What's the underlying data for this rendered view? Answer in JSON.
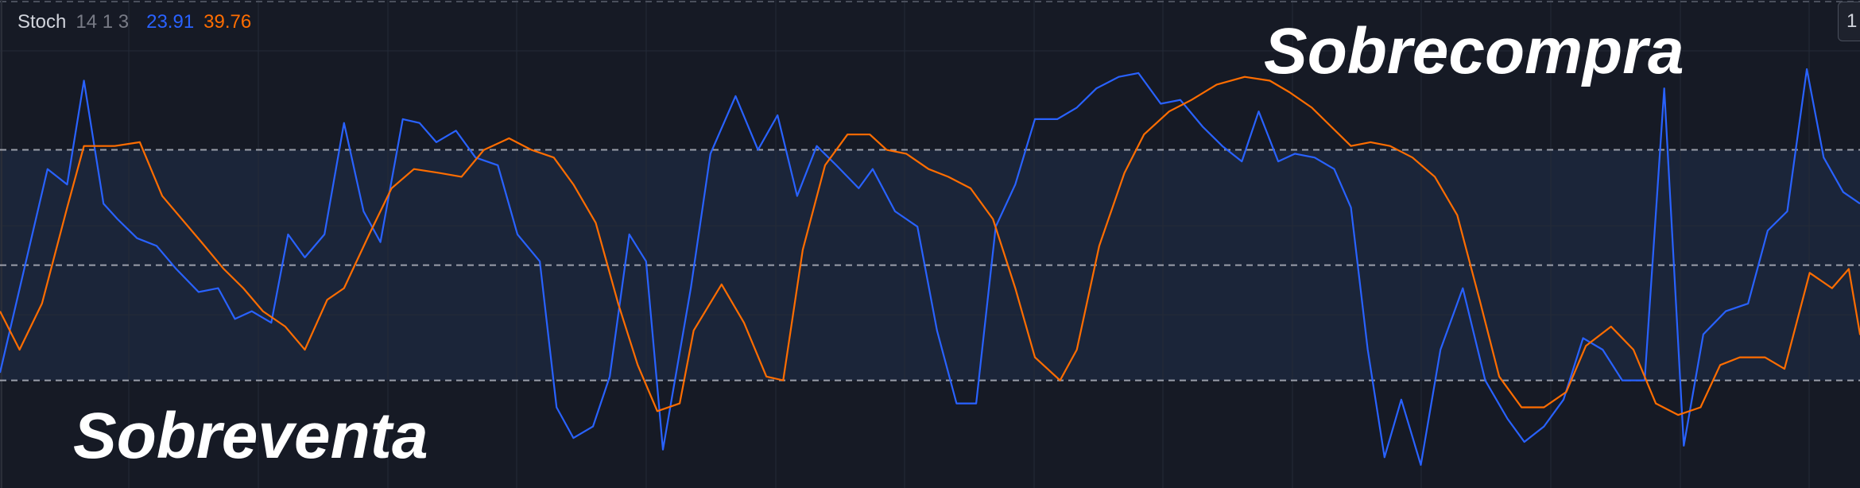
{
  "indicator": {
    "name": "Stoch",
    "params": "14 1 3",
    "k_value": "23.91",
    "d_value": "39.76",
    "k_color": "#2962ff",
    "d_color": "#ff6d00"
  },
  "annotations": {
    "overbought": "Sobrecompra",
    "oversold": "Sobreventa"
  },
  "edge_button": "1",
  "colors": {
    "background": "#161a25",
    "band_fill": "#1b2539",
    "grid": "#242a38",
    "band_line": "#b2b5be",
    "text": "#ffffff"
  },
  "chart_data": {
    "type": "line",
    "ylim": [
      -8,
      119
    ],
    "upper_band": 80,
    "middle_band": 50,
    "lower_band": 20,
    "grid": true,
    "series": [
      {
        "name": "%K",
        "color": "#2962ff",
        "points": [
          [
            0,
            22
          ],
          [
            34,
            75
          ],
          [
            48,
            71
          ],
          [
            60,
            98
          ],
          [
            74,
            66
          ],
          [
            84,
            62
          ],
          [
            98,
            57
          ],
          [
            112,
            55
          ],
          [
            126,
            49
          ],
          [
            142,
            43
          ],
          [
            156,
            44
          ],
          [
            168,
            36
          ],
          [
            180,
            38
          ],
          [
            194,
            35
          ],
          [
            206,
            58
          ],
          [
            218,
            52
          ],
          [
            232,
            58
          ],
          [
            246,
            87
          ],
          [
            260,
            64
          ],
          [
            272,
            56
          ],
          [
            288,
            88
          ],
          [
            300,
            87
          ],
          [
            312,
            82
          ],
          [
            326,
            85
          ],
          [
            340,
            78
          ],
          [
            356,
            76
          ],
          [
            370,
            58
          ],
          [
            386,
            51
          ],
          [
            398,
            13
          ],
          [
            410,
            5
          ],
          [
            424,
            8
          ],
          [
            436,
            21
          ],
          [
            450,
            58
          ],
          [
            462,
            51
          ],
          [
            474,
            2
          ],
          [
            494,
            44
          ],
          [
            508,
            79
          ],
          [
            526,
            94
          ],
          [
            542,
            80
          ],
          [
            556,
            89
          ],
          [
            570,
            68
          ],
          [
            584,
            81
          ],
          [
            598,
            76
          ],
          [
            614,
            70
          ],
          [
            624,
            75
          ],
          [
            640,
            64
          ],
          [
            656,
            60
          ],
          [
            670,
            33
          ],
          [
            684,
            14
          ],
          [
            698,
            14
          ],
          [
            712,
            60
          ],
          [
            726,
            71
          ],
          [
            740,
            88
          ],
          [
            756,
            88
          ],
          [
            770,
            91
          ],
          [
            784,
            96
          ],
          [
            800,
            99
          ],
          [
            814,
            100
          ],
          [
            830,
            92
          ],
          [
            844,
            93
          ],
          [
            860,
            86
          ],
          [
            874,
            81
          ],
          [
            888,
            77
          ],
          [
            900,
            90
          ],
          [
            914,
            77
          ],
          [
            926,
            79
          ],
          [
            940,
            78
          ],
          [
            954,
            75
          ],
          [
            966,
            65
          ],
          [
            978,
            28
          ],
          [
            990,
            0
          ],
          [
            1002,
            15
          ],
          [
            1016,
            -2
          ],
          [
            1030,
            28
          ],
          [
            1046,
            44
          ],
          [
            1062,
            20
          ],
          [
            1078,
            10
          ],
          [
            1090,
            4
          ],
          [
            1104,
            8
          ],
          [
            1118,
            15
          ],
          [
            1132,
            31
          ],
          [
            1146,
            28
          ],
          [
            1160,
            20
          ],
          [
            1176,
            20
          ],
          [
            1190,
            96
          ],
          [
            1204,
            3
          ],
          [
            1218,
            32
          ],
          [
            1234,
            38
          ],
          [
            1250,
            40
          ],
          [
            1264,
            59
          ],
          [
            1278,
            64
          ],
          [
            1292,
            101
          ],
          [
            1304,
            78
          ],
          [
            1318,
            69
          ],
          [
            1330,
            66
          ]
        ]
      },
      {
        "name": "%D",
        "color": "#ff6d00",
        "points": [
          [
            0,
            38
          ],
          [
            14,
            28
          ],
          [
            30,
            40
          ],
          [
            48,
            65
          ],
          [
            60,
            81
          ],
          [
            82,
            81
          ],
          [
            100,
            82
          ],
          [
            116,
            68
          ],
          [
            130,
            62
          ],
          [
            144,
            56
          ],
          [
            160,
            49
          ],
          [
            174,
            44
          ],
          [
            188,
            38
          ],
          [
            204,
            34
          ],
          [
            218,
            28
          ],
          [
            234,
            41
          ],
          [
            246,
            44
          ],
          [
            264,
            58
          ],
          [
            280,
            70
          ],
          [
            296,
            75
          ],
          [
            314,
            74
          ],
          [
            330,
            73
          ],
          [
            346,
            80
          ],
          [
            364,
            83
          ],
          [
            380,
            80
          ],
          [
            396,
            78
          ],
          [
            410,
            71
          ],
          [
            426,
            61
          ],
          [
            442,
            40
          ],
          [
            456,
            24
          ],
          [
            470,
            12
          ],
          [
            486,
            14
          ],
          [
            496,
            33
          ],
          [
            516,
            45
          ],
          [
            532,
            35
          ],
          [
            548,
            21
          ],
          [
            560,
            20
          ],
          [
            574,
            54
          ],
          [
            590,
            76
          ],
          [
            606,
            84
          ],
          [
            622,
            84
          ],
          [
            634,
            80
          ],
          [
            648,
            79
          ],
          [
            664,
            75
          ],
          [
            678,
            73
          ],
          [
            694,
            70
          ],
          [
            710,
            62
          ],
          [
            726,
            44
          ],
          [
            740,
            26
          ],
          [
            758,
            20
          ],
          [
            770,
            28
          ],
          [
            786,
            55
          ],
          [
            804,
            74
          ],
          [
            818,
            84
          ],
          [
            836,
            90
          ],
          [
            852,
            93
          ],
          [
            870,
            97
          ],
          [
            890,
            99
          ],
          [
            908,
            98
          ],
          [
            922,
            95
          ],
          [
            938,
            91
          ],
          [
            952,
            86
          ],
          [
            966,
            81
          ],
          [
            980,
            82
          ],
          [
            994,
            81
          ],
          [
            1010,
            78
          ],
          [
            1026,
            73
          ],
          [
            1042,
            63
          ],
          [
            1058,
            41
          ],
          [
            1072,
            21
          ],
          [
            1088,
            13
          ],
          [
            1104,
            13
          ],
          [
            1120,
            17
          ],
          [
            1134,
            29
          ],
          [
            1152,
            34
          ],
          [
            1168,
            28
          ],
          [
            1184,
            14
          ],
          [
            1200,
            11
          ],
          [
            1216,
            13
          ],
          [
            1230,
            24
          ],
          [
            1244,
            26
          ],
          [
            1262,
            26
          ],
          [
            1276,
            23
          ],
          [
            1294,
            48
          ],
          [
            1310,
            44
          ],
          [
            1322,
            49
          ],
          [
            1330,
            32
          ],
          [
            1346,
            42
          ],
          [
            1360,
            51
          ],
          [
            1376,
            62
          ],
          [
            1392,
            72
          ],
          [
            1406,
            78
          ],
          [
            1424,
            79
          ],
          [
            1436,
            79
          ],
          [
            1452,
            71
          ]
        ]
      }
    ]
  }
}
